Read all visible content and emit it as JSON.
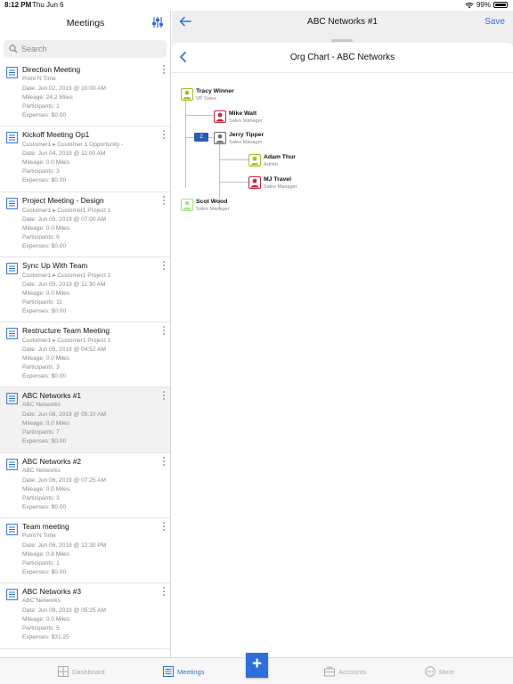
{
  "status_bar": {
    "time": "8:12 PM",
    "date": "Thu Jun 6",
    "battery": "99%"
  },
  "left": {
    "title": "Meetings",
    "search_placeholder": "Search",
    "meetings": [
      {
        "title": "Direction Meeting",
        "lines": [
          "Point N Time",
          "Date: Jun 02, 2019 @ 10:00 AM",
          "Mileage: 24.2 Miles",
          "Participants: 1",
          "Expenses: $0.00"
        ]
      },
      {
        "title": "Kickoff Meeting Op1",
        "lines": [
          "Customer1 ▸ Customer 1 Opportunity -",
          "Date: Jun 04, 2019 @ 11:00 AM",
          "Mileage: 0.0 Miles",
          "Participants: 3",
          "Expenses: $0.00"
        ]
      },
      {
        "title": "Project Meeting - Design",
        "lines": [
          "Customer1 ▸ Customer1 Project 1",
          "Date: Jun 05, 2019 @ 07:00 AM",
          "Mileage: 0.0 Miles",
          "Participants: 6",
          "Expenses: $0.00"
        ]
      },
      {
        "title": "Sync Up With Team",
        "lines": [
          "Customer1 ▸ Customer1 Project 1",
          "Date: Jun 05, 2019 @ 11:30 AM",
          "Mileage: 0.0 Miles",
          "Participants: 11",
          "Expenses: $0.00"
        ]
      },
      {
        "title": "Restructure Team Meeting",
        "lines": [
          "Customer1 ▸ Customer1 Project 1",
          "Date: Jun 05, 2019 @ 04:52 AM",
          "Mileage: 0.0 Miles",
          "Participants: 3",
          "Expenses: $0.00"
        ]
      },
      {
        "title": "ABC Networks #1",
        "lines": [
          "ABC Networks",
          "Date: Jun 06, 2019 @ 05:10 AM",
          "Mileage: 0.0 Miles",
          "Participants: 7",
          "Expenses: $0.00"
        ]
      },
      {
        "title": "ABC Networks #2",
        "lines": [
          "ABC Networks",
          "Date: Jun 06, 2019 @ 07:25 AM",
          "Mileage: 0.0 Miles",
          "Participants: 3",
          "Expenses: $0.00"
        ]
      },
      {
        "title": "Team meeting",
        "lines": [
          "Point N Time",
          "Date: Jun 06, 2019 @ 12:30 PM",
          "Mileage: 0.8 Miles",
          "Participants: 1",
          "Expenses: $0.00"
        ]
      },
      {
        "title": "ABC Networks #3",
        "lines": [
          "ABC Networks",
          "Date: Jun 08, 2019 @ 05:25 AM",
          "Mileage: 0.0 Miles",
          "Participants: 5",
          "Expenses: $31.25"
        ]
      }
    ]
  },
  "right": {
    "nav_title": "ABC Networks #1",
    "save_label": "Save",
    "sheet_title": "Org Chart - ABC Networks",
    "org": [
      {
        "name": "Tracy Winner",
        "role": "VP Sales",
        "color": "#9cc42a"
      },
      {
        "name": "Mike Walt",
        "role": "Sales Manager",
        "color": "#c8233c"
      },
      {
        "name": "Jerry Tipper",
        "role": "Sales Manager",
        "color": "#6d6d6d",
        "badge": "2"
      },
      {
        "name": "Adam Thur",
        "role": "Admin",
        "color": "#9cc42a"
      },
      {
        "name": "MJ Travel",
        "role": "Sales Manager",
        "color": "#c8233c"
      },
      {
        "name": "Scot Wood",
        "role": "Sales Manager",
        "color": "#a6e08a"
      }
    ]
  },
  "tabs": [
    {
      "label": "Dashboard",
      "icon": "dashboard-icon"
    },
    {
      "label": "Meetings",
      "icon": "meetings-icon",
      "active": true
    },
    {
      "label": "Accounts",
      "icon": "briefcase-icon"
    },
    {
      "label": "More",
      "icon": "more-icon"
    }
  ],
  "colors": {
    "accent": "#2f6fdb"
  }
}
